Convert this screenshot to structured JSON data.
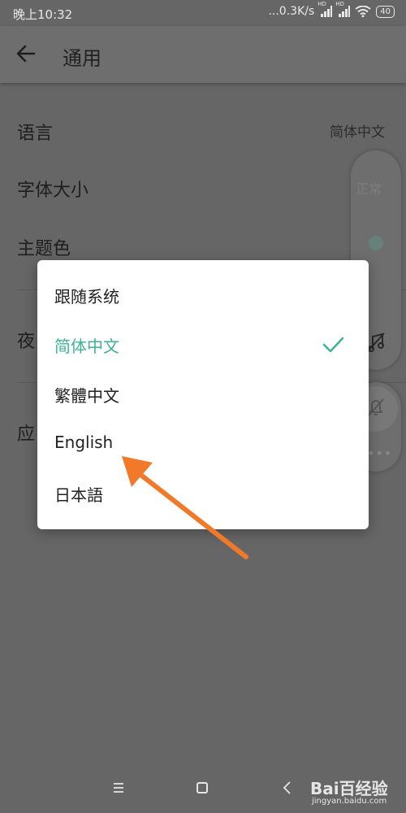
{
  "status_bar": {
    "time": "晚上10:32",
    "network_speed": "...0.3K/s",
    "battery": "40"
  },
  "app_bar": {
    "title": "通用"
  },
  "settings": {
    "language": {
      "label": "语言",
      "value": "简体中文"
    },
    "font_size": {
      "label": "字体大小",
      "value": "正常"
    },
    "theme_color": {
      "label": "主题色"
    },
    "night_mode": {
      "label": "夜"
    },
    "app_item": {
      "label": "应"
    }
  },
  "language_dialog": {
    "options": [
      {
        "label": "跟随系统"
      },
      {
        "label": "简体中文",
        "selected": true
      },
      {
        "label": "繁體中文"
      },
      {
        "label": "English"
      },
      {
        "label": "日本語"
      }
    ],
    "accent_color": "#3cb495"
  },
  "watermark": {
    "brand": "Bai百经验",
    "url": "jingyan.baidu.com"
  },
  "icons": [
    "back-arrow-icon",
    "check-icon",
    "music-off-icon",
    "bell-off-icon",
    "more-icon",
    "menu-icon",
    "home-icon",
    "nav-back-icon"
  ]
}
